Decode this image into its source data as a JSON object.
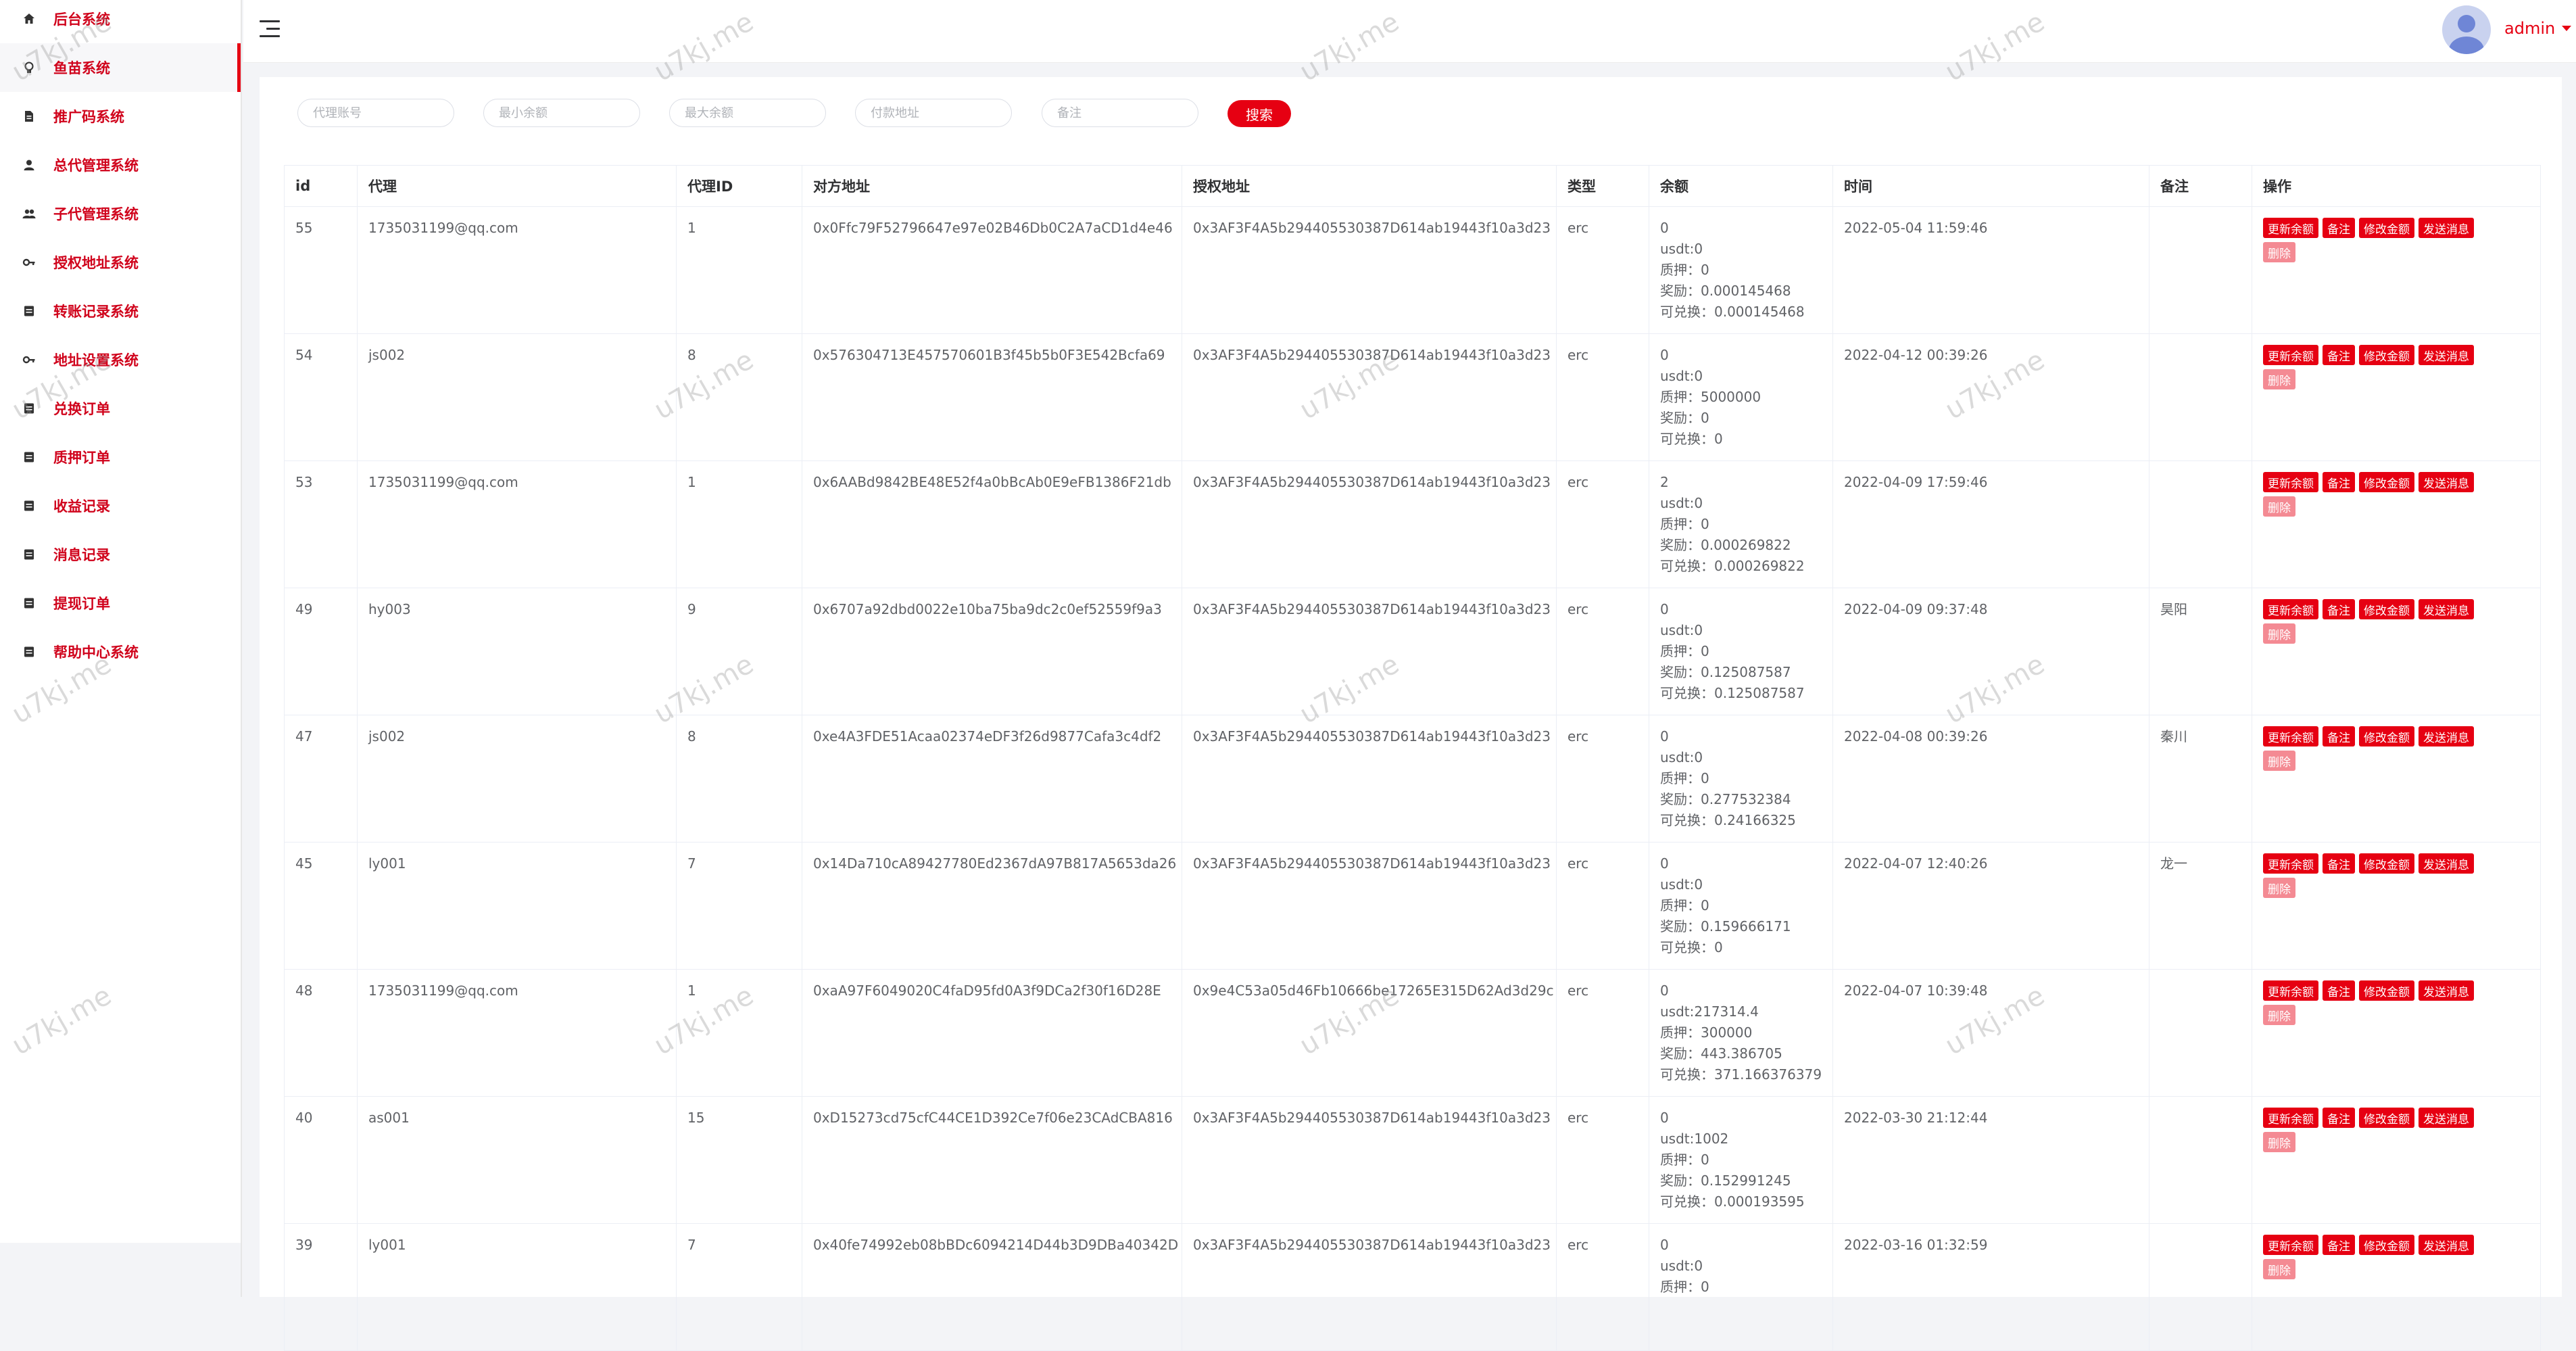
{
  "sidebar": {
    "items": [
      {
        "label": "后台系统",
        "icon": "home-icon"
      },
      {
        "label": "鱼苗系统",
        "icon": "bulb-icon"
      },
      {
        "label": "推广码系统",
        "icon": "document-icon"
      },
      {
        "label": "总代管理系统",
        "icon": "user-icon"
      },
      {
        "label": "子代管理系统",
        "icon": "users-icon"
      },
      {
        "label": "授权地址系统",
        "icon": "key-icon"
      },
      {
        "label": "转账记录系统",
        "icon": "list-icon"
      },
      {
        "label": "地址设置系统",
        "icon": "key-icon"
      },
      {
        "label": "兑换订单",
        "icon": "list-icon"
      },
      {
        "label": "质押订单",
        "icon": "list-icon"
      },
      {
        "label": "收益记录",
        "icon": "list-icon"
      },
      {
        "label": "消息记录",
        "icon": "list-icon"
      },
      {
        "label": "提现订单",
        "icon": "list-icon"
      },
      {
        "label": "帮助中心系统",
        "icon": "list-icon"
      }
    ]
  },
  "header": {
    "user_name": "admin"
  },
  "filters": {
    "agent_account_placeholder": "代理账号",
    "min_balance_placeholder": "最小余额",
    "max_balance_placeholder": "最大余额",
    "pay_address_placeholder": "付款地址",
    "remark_placeholder": "备注",
    "search_label": "搜索"
  },
  "table": {
    "headers": {
      "id": "id",
      "agent": "代理",
      "agent_id": "代理ID",
      "peer_address": "对方地址",
      "auth_address": "授权地址",
      "type": "类型",
      "balance": "余额",
      "time": "时间",
      "remark": "备注",
      "ops": "操作"
    },
    "labels": {
      "usdt": "usdt:",
      "pledge": "质押：",
      "reward": "奖励：",
      "exchangeable": "可兑换：",
      "btn_update": "更新余额",
      "btn_remark": "备注",
      "btn_edit": "修改金额",
      "btn_message": "发送消息",
      "btn_delete": "删除"
    },
    "rows": [
      {
        "id": "55",
        "agent": "1735031199@qq.com",
        "agent_id": "1",
        "peer_address": "0x0Ffc79F52796647e97e02B46Db0C2A7aCD1d4e46",
        "auth_address": "0x3AF3F4A5b294405530387D614ab19443f10a3d23",
        "type": "erc",
        "balance": "0",
        "usdt": "0",
        "pledge": "0",
        "reward": "0.000145468",
        "exchangeable": "0.000145468",
        "time": "2022-05-04 11:59:46",
        "remark": ""
      },
      {
        "id": "54",
        "agent": "js002",
        "agent_id": "8",
        "peer_address": "0x576304713E457570601B3f45b5b0F3E542Bcfa69",
        "auth_address": "0x3AF3F4A5b294405530387D614ab19443f10a3d23",
        "type": "erc",
        "balance": "0",
        "usdt": "0",
        "pledge": "5000000",
        "reward": "0",
        "exchangeable": "0",
        "time": "2022-04-12 00:39:26",
        "remark": ""
      },
      {
        "id": "53",
        "agent": "1735031199@qq.com",
        "agent_id": "1",
        "peer_address": "0x6AABd9842BE48E52f4a0bBcAb0E9eFB1386F21db",
        "auth_address": "0x3AF3F4A5b294405530387D614ab19443f10a3d23",
        "type": "erc",
        "balance": "2",
        "usdt": "0",
        "pledge": "0",
        "reward": "0.000269822",
        "exchangeable": "0.000269822",
        "time": "2022-04-09 17:59:46",
        "remark": ""
      },
      {
        "id": "49",
        "agent": "hy003",
        "agent_id": "9",
        "peer_address": "0x6707a92dbd0022e10ba75ba9dc2c0ef52559f9a3",
        "auth_address": "0x3AF3F4A5b294405530387D614ab19443f10a3d23",
        "type": "erc",
        "balance": "0",
        "usdt": "0",
        "pledge": "0",
        "reward": "0.125087587",
        "exchangeable": "0.125087587",
        "time": "2022-04-09 09:37:48",
        "remark": "昊阳"
      },
      {
        "id": "47",
        "agent": "js002",
        "agent_id": "8",
        "peer_address": "0xe4A3FDE51Acaa02374eDF3f26d9877Cafa3c4df2",
        "auth_address": "0x3AF3F4A5b294405530387D614ab19443f10a3d23",
        "type": "erc",
        "balance": "0",
        "usdt": "0",
        "pledge": "0",
        "reward": "0.277532384",
        "exchangeable": "0.24166325",
        "time": "2022-04-08 00:39:26",
        "remark": "秦川"
      },
      {
        "id": "45",
        "agent": "ly001",
        "agent_id": "7",
        "peer_address": "0x14Da710cA89427780Ed2367dA97B817A5653da26",
        "auth_address": "0x3AF3F4A5b294405530387D614ab19443f10a3d23",
        "type": "erc",
        "balance": "0",
        "usdt": "0",
        "pledge": "0",
        "reward": "0.159666171",
        "exchangeable": "0",
        "time": "2022-04-07 12:40:26",
        "remark": "龙一"
      },
      {
        "id": "48",
        "agent": "1735031199@qq.com",
        "agent_id": "1",
        "peer_address": "0xaA97F6049020C4faD95fd0A3f9DCa2f30f16D28E",
        "auth_address": "0x9e4C53a05d46Fb10666be17265E315D62Ad3d29c",
        "type": "erc",
        "balance": "0",
        "usdt": "217314.4",
        "pledge": "300000",
        "reward": "443.386705",
        "exchangeable": "371.166376379",
        "time": "2022-04-07 10:39:48",
        "remark": ""
      },
      {
        "id": "40",
        "agent": "as001",
        "agent_id": "15",
        "peer_address": "0xD15273cd75cfC44CE1D392Ce7f06e23CAdCBA816",
        "auth_address": "0x3AF3F4A5b294405530387D614ab19443f10a3d23",
        "type": "erc",
        "balance": "0",
        "usdt": "1002",
        "pledge": "0",
        "reward": "0.152991245",
        "exchangeable": "0.000193595",
        "time": "2022-03-30 21:12:44",
        "remark": ""
      },
      {
        "id": "39",
        "agent": "ly001",
        "agent_id": "7",
        "peer_address": "0x40fe74992eb08bBDc6094214D44b3D9DBa40342D",
        "auth_address": "0x3AF3F4A5b294405530387D614ab19443f10a3d23",
        "type": "erc",
        "balance": "0",
        "usdt": "0",
        "pledge": "0",
        "reward": "",
        "exchangeable": "",
        "time": "2022-03-16 01:32:59",
        "remark": ""
      }
    ]
  },
  "watermark": "u7kj.me"
}
